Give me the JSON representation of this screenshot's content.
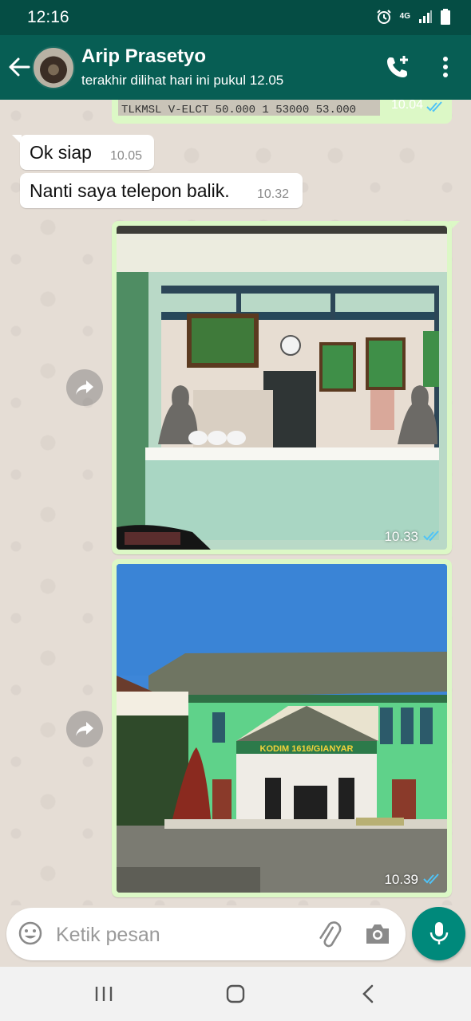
{
  "status_bar": {
    "time": "12:16",
    "network": "4G",
    "icons": [
      "alarm-icon",
      "network-4g-icon",
      "signal-icon",
      "battery-icon"
    ]
  },
  "header": {
    "contact_name": "Arip Prasetyo",
    "last_seen": "terakhir dilihat hari ini pukul 12.05",
    "icons": [
      "back-arrow-icon",
      "add-call-icon",
      "more-vert-icon"
    ]
  },
  "messages": [
    {
      "type": "image",
      "direction": "outgoing",
      "time": "10.04",
      "visible_text": "TLKMSL V-ELCT 50.000   1  53000   53.000",
      "status": "read"
    },
    {
      "type": "text",
      "direction": "incoming",
      "text": "Ok siap",
      "time": "10.05"
    },
    {
      "type": "text",
      "direction": "incoming",
      "text": "Nanti saya telepon balik.",
      "time": "10.32"
    },
    {
      "type": "image",
      "direction": "outgoing",
      "time": "10.33",
      "status": "read"
    },
    {
      "type": "image",
      "direction": "outgoing",
      "time": "10.39",
      "status": "read",
      "sign_text": "KODIM 1616/GIANYAR"
    }
  ],
  "input": {
    "placeholder": "Ketik pesan",
    "value": ""
  },
  "colors": {
    "header": "#075e54",
    "status_bar": "#054d44",
    "outgoing_bubble": "#dcf8c6",
    "incoming_bubble": "#ffffff",
    "accent": "#00897b",
    "read_ticks": "#4fc3f7"
  }
}
